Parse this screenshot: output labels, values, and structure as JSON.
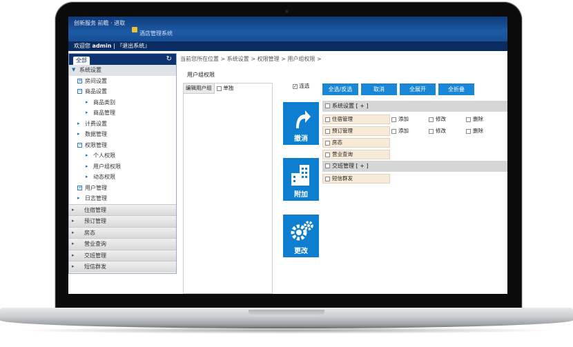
{
  "header": {
    "logo_text": "创新服务 前瞻 · 进取",
    "app_title": "酒店管理系统"
  },
  "userbar": {
    "welcome": "欢迎您",
    "username": "admin",
    "separator": "|",
    "logout": "『退出系统』"
  },
  "sidebar": {
    "tab_label": "全部",
    "tree": [
      {
        "label": "系统设置",
        "level": 0,
        "marker": "▼",
        "active": true
      },
      {
        "label": "房间设置",
        "level": 1,
        "marker": "plus"
      },
      {
        "label": "商品设置",
        "level": 1,
        "marker": "minus"
      },
      {
        "label": "商品类别",
        "level": 2,
        "marker": "arrow"
      },
      {
        "label": "商品管理",
        "level": 2,
        "marker": "arrow"
      },
      {
        "label": "计费设置",
        "level": 1,
        "marker": "arrow"
      },
      {
        "label": "数据管理",
        "level": 1,
        "marker": "arrow"
      },
      {
        "label": "权限管理",
        "level": 1,
        "marker": "minus"
      },
      {
        "label": "个人权限",
        "level": 2,
        "marker": "arrow"
      },
      {
        "label": "用户组权限",
        "level": 2,
        "marker": "arrow"
      },
      {
        "label": "动态权限",
        "level": 2,
        "marker": "arrow"
      },
      {
        "label": "用户管理",
        "level": 1,
        "marker": "plus"
      },
      {
        "label": "日志管理",
        "level": 1,
        "marker": "arrow"
      }
    ],
    "groups": [
      "住宿管理",
      "预订管理",
      "房态",
      "营业查询",
      "交班管理",
      "短信群发"
    ]
  },
  "breadcrumb": "当前您所在位置 > 系统设置 > 权限管理 > 用户组权限 >",
  "content_title": "用户组权限",
  "left_panel": {
    "edit_group_label": "编辑用户组",
    "single_select_label": "单独"
  },
  "linked_label": "连选",
  "buttons": {
    "select_invert": "全选/反选",
    "cancel": "取消",
    "expand_all": "全展开",
    "collapse_all": "全折叠"
  },
  "tiles": {
    "undo": "撤消",
    "attach": "附加",
    "change": "更改"
  },
  "permissions": {
    "section1": "系统设置 [ + ]",
    "section2": "交班管理 [ + ]",
    "items": [
      "住宿管理",
      "预订管理",
      "房态",
      "营业查询"
    ],
    "section2_items": [
      "短信群发"
    ],
    "ops": [
      "添加",
      "修改",
      "删除"
    ]
  },
  "colors": {
    "header_blue": "#1d5aa5",
    "button_blue": "#1a86d6",
    "item_bg": "#f7ead8"
  }
}
